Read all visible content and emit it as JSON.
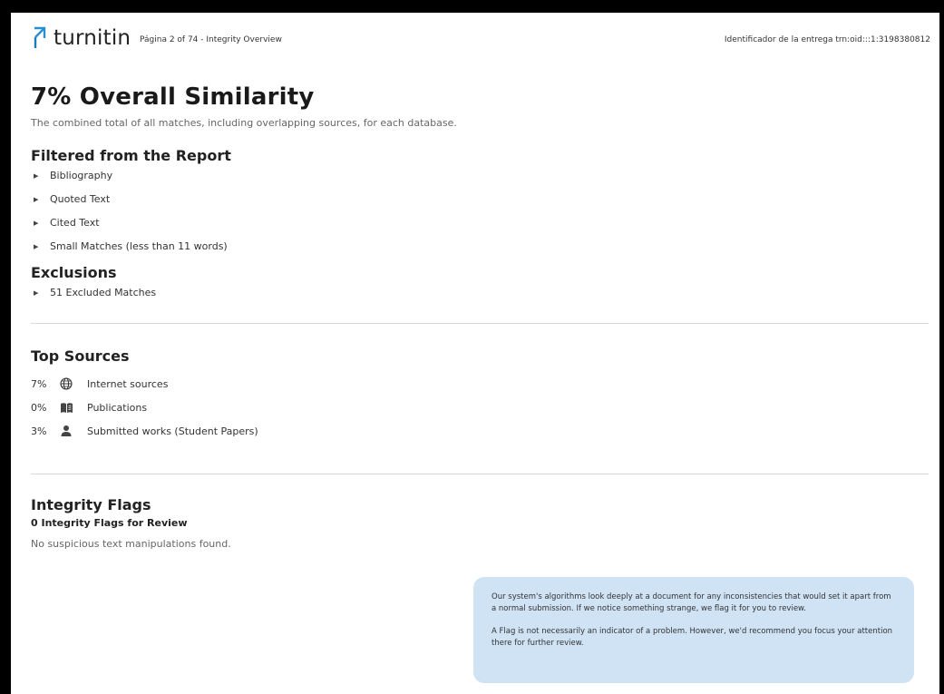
{
  "header": {
    "logo_text": "turnitin",
    "page_info": "Página 2 of 74 - Integrity Overview",
    "submission_id": "Identificador de la entrega trn:oid:::1:3198380812"
  },
  "overview": {
    "title": "7% Overall Similarity",
    "subtitle": "The combined total of all matches, including overlapping sources, for each database."
  },
  "filtered": {
    "heading": "Filtered from the Report",
    "items": [
      "Bibliography",
      "Quoted Text",
      "Cited Text",
      "Small Matches (less than 11 words)"
    ]
  },
  "exclusions": {
    "heading": "Exclusions",
    "items": [
      "51 Excluded Matches"
    ]
  },
  "top_sources": {
    "heading": "Top Sources",
    "rows": [
      {
        "pct": "7%",
        "icon": "globe-icon",
        "label": "Internet sources"
      },
      {
        "pct": "0%",
        "icon": "book-icon",
        "label": "Publications"
      },
      {
        "pct": "3%",
        "icon": "person-icon",
        "label": "Submitted works (Student Papers)"
      }
    ]
  },
  "integrity_flags": {
    "heading": "Integrity Flags",
    "count_text": "0 Integrity Flags for Review",
    "status_text": "No suspicious text manipulations found.",
    "info_p1": "Our system's algorithms look deeply at a document for any inconsistencies that would set it apart from a normal submission. If we notice something strange, we flag it for you to review.",
    "info_p2": "A Flag is not necessarily an indicator of a problem. However, we'd recommend you focus your attention there for further review."
  },
  "colors": {
    "brand": "#1f7ab8",
    "info_box": "#cfe3f5"
  }
}
